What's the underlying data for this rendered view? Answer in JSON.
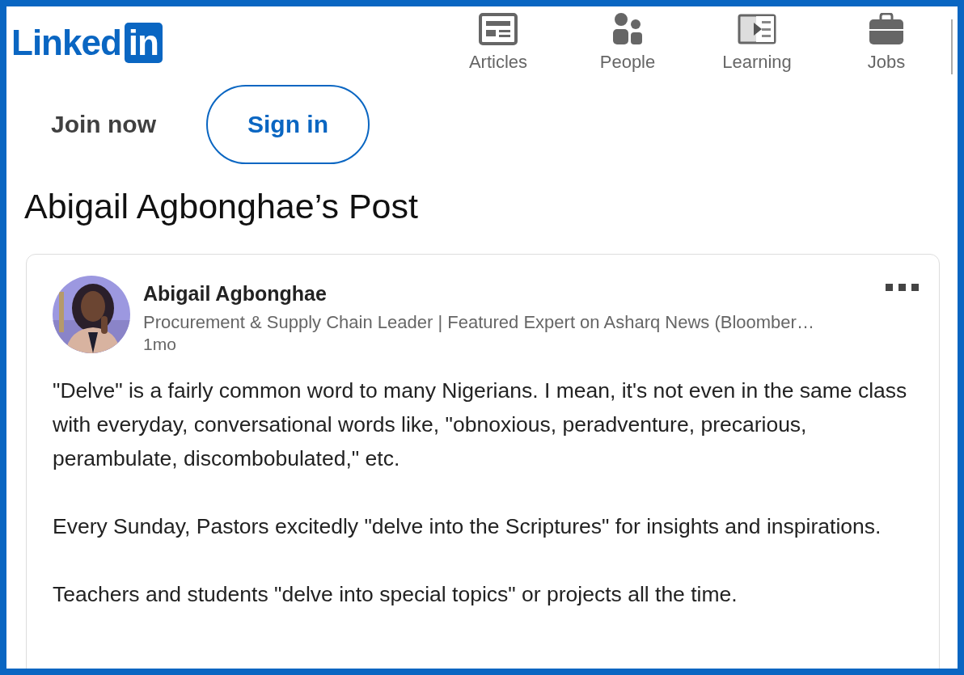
{
  "logo": {
    "word": "Linked",
    "badge": "in"
  },
  "nav": [
    {
      "label": "Articles"
    },
    {
      "label": "People"
    },
    {
      "label": "Learning"
    },
    {
      "label": "Jobs"
    }
  ],
  "auth": {
    "join": "Join now",
    "sign_in": "Sign in"
  },
  "page_title": "Abigail Agbonghae’s Post",
  "post": {
    "author": "Abigail Agbonghae",
    "headline": "Procurement & Supply Chain Leader | Featured Expert on Asharq News (Bloomber…",
    "time": "1mo",
    "avatar": {
      "kind": "picture"
    },
    "paragraphs": [
      "\"Delve\" is a fairly common word to many Nigerians. I mean, it's not even in the same class with everyday, conversational words like, \"obnoxious, peradventure, precarious, perambulate, discombobulated,\" etc.",
      "Every Sunday, Pastors excitedly \"delve into the Scriptures\" for insights and inspirations.",
      "Teachers and students \"delve into special topics\" or projects all the time."
    ]
  }
}
